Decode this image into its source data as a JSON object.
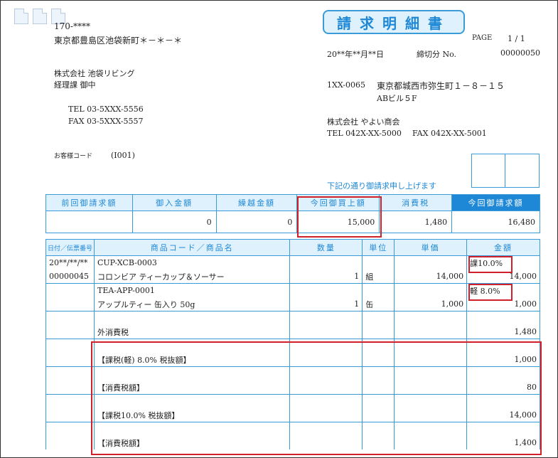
{
  "header": {
    "postal": "170-****",
    "address": "東京都豊島区池袋新町＊－＊－＊",
    "company": "株式会社 池袋リビング",
    "dept": "経理課 御中",
    "tel": "TEL 03-5XXX-5556",
    "fax": "FAX 03-5XXX-5557",
    "customer_code_label": "お客様コード",
    "customer_code": "(I001)",
    "title": "請求明細書",
    "page_label": "PAGE",
    "page_value": "1 / 1",
    "date": "20**年**月**日",
    "closing_label": "締切分 No.",
    "closing_no": "00000050",
    "issuer_postal": "1XX-0065",
    "issuer_address": "東京都城西市弥生町１－８－１５",
    "issuer_building": "ABビル５F",
    "issuer_company": "株式会社 やよい商会",
    "issuer_tel": "TEL 042X-XX-5000",
    "issuer_fax": "FAX 042X-XX-5001",
    "notice": "下記の通り御請求申し上げます"
  },
  "summary": {
    "headers": [
      "前回御請求額",
      "御入金額",
      "繰越金額",
      "今回御買上額",
      "消費税",
      "今回御請求額"
    ],
    "values": [
      "",
      "0",
      "0",
      "15,000",
      "1,480",
      "16,480"
    ]
  },
  "detail": {
    "headers": [
      "日付／伝票番号",
      "商品コード／商品名",
      "数量",
      "単位",
      "単価",
      "金額"
    ],
    "rows": [
      [
        "20**/**/**",
        "CUP-XCB-0003",
        "",
        "",
        "",
        "課10.0%"
      ],
      [
        "00000045",
        "コロンビア ティーカップ＆ソーサー",
        "1",
        "組",
        "14,000",
        "14,000"
      ],
      [
        "",
        "TEA-APP-0001",
        "",
        "",
        "",
        "軽 8.0%"
      ],
      [
        "",
        "アップルティー 缶入り 50g",
        "1",
        "缶",
        "1,000",
        "1,000"
      ],
      [
        "",
        "",
        "",
        "",
        "",
        ""
      ],
      [
        "",
        "外消費税",
        "",
        "",
        "",
        "1,480"
      ],
      [
        "",
        "",
        "",
        "",
        "",
        ""
      ],
      [
        "",
        "【課税(軽) 8.0% 税抜額】",
        "",
        "",
        "",
        "1,000"
      ],
      [
        "",
        "",
        "",
        "",
        "",
        ""
      ],
      [
        "",
        "【消費税額】",
        "",
        "",
        "",
        "80"
      ],
      [
        "",
        "",
        "",
        "",
        "",
        ""
      ],
      [
        "",
        "【課税10.0% 税抜額】",
        "",
        "",
        "",
        "14,000"
      ],
      [
        "",
        "",
        "",
        "",
        "",
        ""
      ],
      [
        "",
        "【消費税額】",
        "",
        "",
        "",
        "1,400"
      ]
    ]
  },
  "colors": {
    "blue": "#1e88d6",
    "light_blue": "#dff1fc",
    "highlight_red": "#d0202a"
  }
}
